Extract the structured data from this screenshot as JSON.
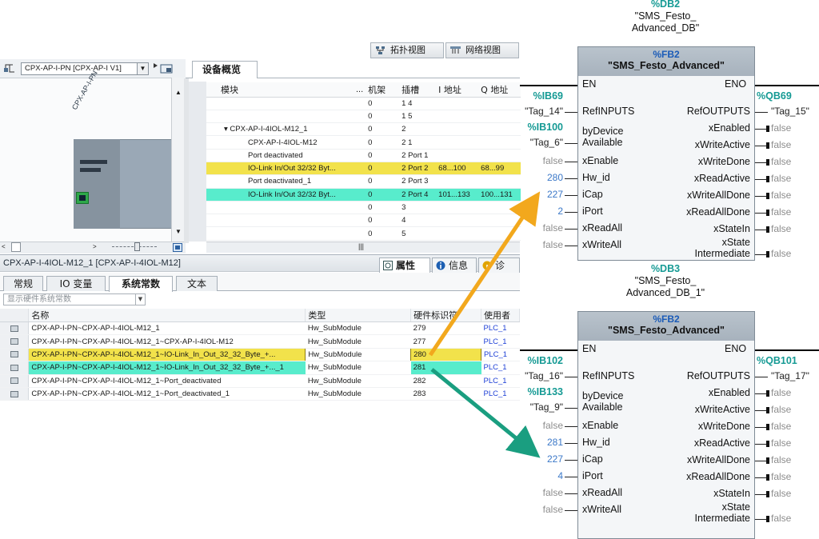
{
  "view_tabs": {
    "topology": "拓扑视图",
    "network": "网络视图"
  },
  "device_selector": {
    "value": "CPX-AP-I-PN [CPX-AP-I V1]"
  },
  "device_label": "CPX-AP-I-PN",
  "overview": {
    "tab_label": "设备概览",
    "columns": [
      "模块",
      "...",
      "机架",
      "插槽",
      "I 地址",
      "Q 地址"
    ],
    "rows": [
      {
        "module": "",
        "rack": "0",
        "slot": "1 4",
        "i": "",
        "q": ""
      },
      {
        "module": "",
        "rack": "0",
        "slot": "1 5",
        "i": "",
        "q": ""
      },
      {
        "module": "▾  CPX-AP-I-4IOL-M12_1",
        "rack": "0",
        "slot": "2",
        "i": "",
        "q": ""
      },
      {
        "module": "CPX-AP-I-4IOL-M12",
        "rack": "0",
        "slot": "2 1",
        "i": "",
        "q": ""
      },
      {
        "module": "Port deactivated",
        "rack": "0",
        "slot": "2 Port 1",
        "i": "",
        "q": ""
      },
      {
        "module": "IO-Link In/Out 32/32 Byt...",
        "rack": "0",
        "slot": "2 Port 2",
        "i": "68...100",
        "q": "68...99"
      },
      {
        "module": "Port deactivated_1",
        "rack": "0",
        "slot": "2 Port 3",
        "i": "",
        "q": ""
      },
      {
        "module": "IO-Link In/Out 32/32 Byt...",
        "rack": "0",
        "slot": "2 Port 4",
        "i": "101...133",
        "q": "100...131"
      },
      {
        "module": "",
        "rack": "0",
        "slot": "3",
        "i": "",
        "q": ""
      },
      {
        "module": "",
        "rack": "0",
        "slot": "4",
        "i": "",
        "q": ""
      },
      {
        "module": "",
        "rack": "0",
        "slot": "5",
        "i": "",
        "q": ""
      }
    ]
  },
  "properties": {
    "title": "CPX-AP-I-4IOL-M12_1 [CPX-AP-I-4IOL-M12]",
    "tabs": {
      "props": "属性",
      "info": "信息",
      "diag": "诊"
    },
    "subtabs": [
      "常规",
      "IO 变量",
      "系统常数",
      "文本"
    ],
    "filter": "显示硬件系统常数",
    "columns": [
      "名称",
      "类型",
      "硬件标识符",
      "使用者"
    ],
    "rows": [
      {
        "name": "CPX-AP-I-PN~CPX-AP-I-4IOL-M12_1",
        "type": "Hw_SubModule",
        "hwid": "279",
        "user": "PLC_1"
      },
      {
        "name": "CPX-AP-I-PN~CPX-AP-I-4IOL-M12_1~CPX-AP-I-4IOL-M12",
        "type": "Hw_SubModule",
        "hwid": "277",
        "user": "PLC_1"
      },
      {
        "name": "CPX-AP-I-PN~CPX-AP-I-4IOL-M12_1~IO-Link_In_Out_32_32_Byte_+...",
        "type": "Hw_SubModule",
        "hwid": "280",
        "user": "PLC_1"
      },
      {
        "name": "CPX-AP-I-PN~CPX-AP-I-4IOL-M12_1~IO-Link_In_Out_32_32_Byte_+..._1",
        "type": "Hw_SubModule",
        "hwid": "281",
        "user": "PLC_1"
      },
      {
        "name": "CPX-AP-I-PN~CPX-AP-I-4IOL-M12_1~Port_deactivated",
        "type": "Hw_SubModule",
        "hwid": "282",
        "user": "PLC_1"
      },
      {
        "name": "CPX-AP-I-PN~CPX-AP-I-4IOL-M12_1~Port_deactivated_1",
        "type": "Hw_SubModule",
        "hwid": "283",
        "user": "PLC_1"
      }
    ]
  },
  "fb1": {
    "db": "%DB2",
    "db_name_1": "\"SMS_Festo_",
    "db_name_2": "Advanced_DB\"",
    "fb_no": "%FB2",
    "fb_name": "\"SMS_Festo_Advanced\"",
    "en": "EN",
    "eno": "ENO",
    "in_addr1": "%IB69",
    "in_tag1": "\"Tag_14\"",
    "in_addr2": "%IB100",
    "in_tag2": "\"Tag_6\"",
    "out_addr1": "%QB69",
    "out_tag1": "\"Tag_15\"",
    "inputs": [
      "RefINPUTS",
      "byDevice",
      "Available",
      "xEnable",
      "Hw_id",
      "iCap",
      "iPort",
      "xReadAll",
      "xWriteAll"
    ],
    "input_values": {
      "xEnable": "false",
      "Hw_id": "280",
      "iCap": "227",
      "iPort": "2",
      "xReadAll": "false",
      "xWriteAll": "false"
    },
    "outputs": [
      "RefOUTPUTS",
      "xEnabled",
      "xWriteActive",
      "xWriteDone",
      "xReadActive",
      "xWriteAllDone",
      "xReadAllDone",
      "xStateIn",
      "xState",
      "Intermediate"
    ],
    "out_false": "false"
  },
  "fb2": {
    "db": "%DB3",
    "db_name_1": "\"SMS_Festo_",
    "db_name_2": "Advanced_DB_1\"",
    "fb_no": "%FB2",
    "fb_name": "\"SMS_Festo_Advanced\"",
    "en": "EN",
    "eno": "ENO",
    "in_addr1": "%IB102",
    "in_tag1": "\"Tag_16\"",
    "in_addr2": "%IB133",
    "in_tag2": "\"Tag_9\"",
    "out_addr1": "%QB101",
    "out_tag1": "\"Tag_17\"",
    "inputs": [
      "RefINPUTS",
      "byDevice",
      "Available",
      "xEnable",
      "Hw_id",
      "iCap",
      "iPort",
      "xReadAll",
      "xWriteAll"
    ],
    "input_values": {
      "xEnable": "false",
      "Hw_id": "281",
      "iCap": "227",
      "iPort": "4",
      "xReadAll": "false",
      "xWriteAll": "false"
    },
    "outputs": [
      "RefOUTPUTS",
      "xEnabled",
      "xWriteActive",
      "xWriteDone",
      "xReadActive",
      "xWriteAllDone",
      "xReadAllDone",
      "xStateIn",
      "xState",
      "Intermediate"
    ],
    "out_false": "false"
  },
  "colors": {
    "yellow_highlight": "#f2e24b",
    "teal_highlight": "#58eccc",
    "orange_arrow": "#f2a81d",
    "green_arrow": "#1a9e80"
  }
}
